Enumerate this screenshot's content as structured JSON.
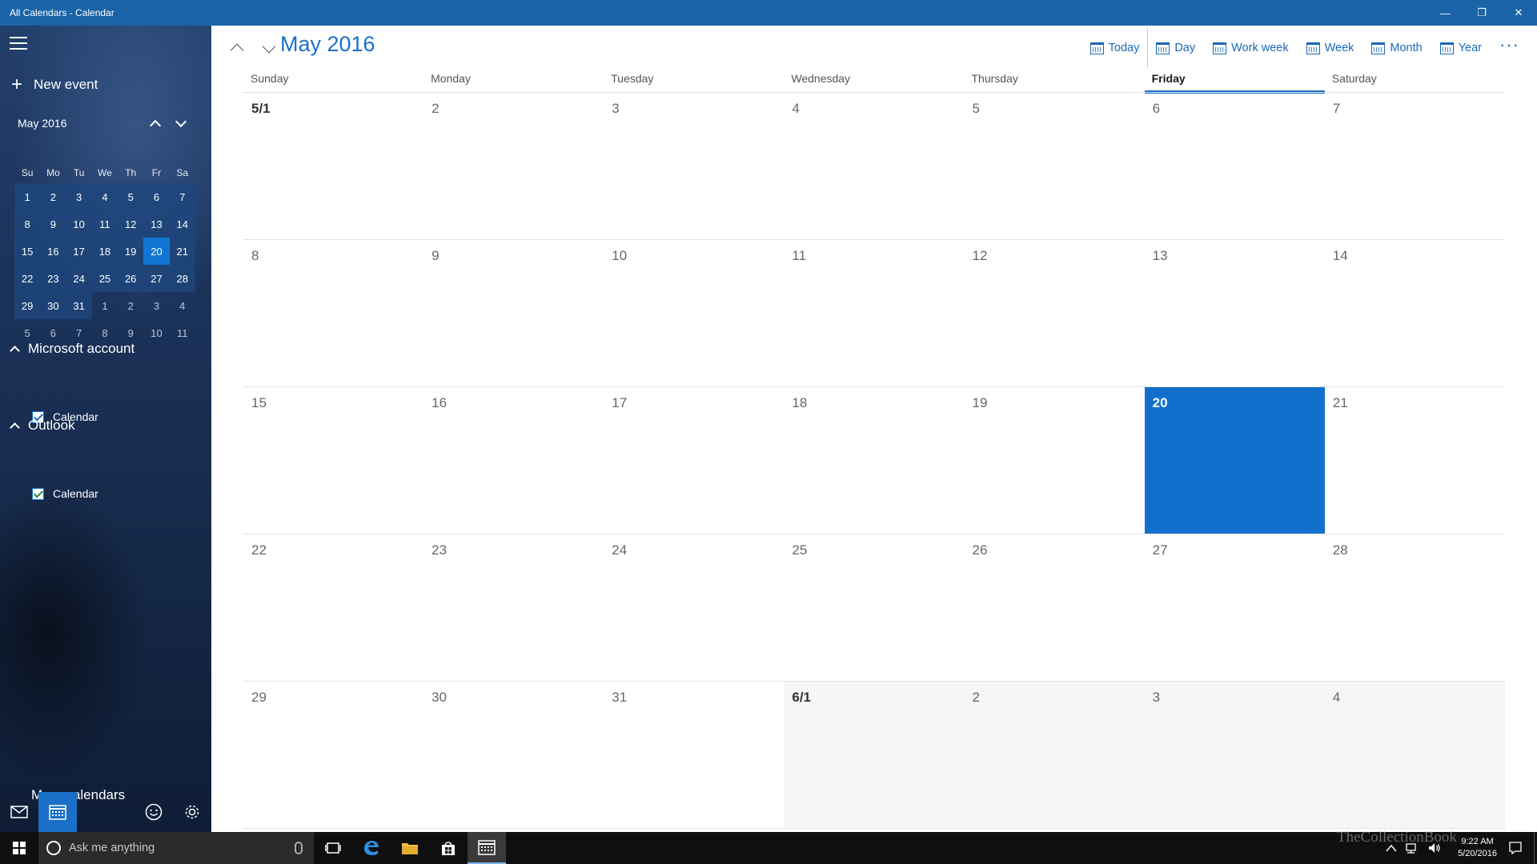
{
  "window": {
    "title": "All Calendars - Calendar",
    "minimize": "—",
    "restore": "❐",
    "close": "✕"
  },
  "sidebar": {
    "new_event_plus": "+",
    "new_event": "New event",
    "mini_calendar": {
      "title": "May 2016",
      "weekdays": [
        "Su",
        "Mo",
        "Tu",
        "We",
        "Th",
        "Fr",
        "Sa"
      ],
      "weeks": [
        [
          "1",
          "2",
          "3",
          "4",
          "5",
          "6",
          "7"
        ],
        [
          "8",
          "9",
          "10",
          "11",
          "12",
          "13",
          "14"
        ],
        [
          "15",
          "16",
          "17",
          "18",
          "19",
          "20",
          "21"
        ],
        [
          "22",
          "23",
          "24",
          "25",
          "26",
          "27",
          "28"
        ],
        [
          "29",
          "30",
          "31",
          "1",
          "2",
          "3",
          "4"
        ],
        [
          "5",
          "6",
          "7",
          "8",
          "9",
          "10",
          "11"
        ]
      ],
      "selected": "20"
    },
    "accounts": [
      {
        "name": "Microsoft account",
        "calendar": "Calendar"
      },
      {
        "name": "Outlook",
        "calendar": "Calendar"
      }
    ],
    "more_calendars": "More calendars"
  },
  "toolbar": {
    "month_title": "May 2016",
    "today": "Today",
    "day": "Day",
    "work_week": "Work week",
    "week": "Week",
    "month": "Month",
    "year": "Year",
    "more": "···"
  },
  "month_view": {
    "weekdays": [
      "Sunday",
      "Monday",
      "Tuesday",
      "Wednesday",
      "Thursday",
      "Friday",
      "Saturday"
    ],
    "today_column": 5,
    "weeks": [
      [
        "5/1",
        "2",
        "3",
        "4",
        "5",
        "6",
        "7"
      ],
      [
        "8",
        "9",
        "10",
        "11",
        "12",
        "13",
        "14"
      ],
      [
        "15",
        "16",
        "17",
        "18",
        "19",
        "20",
        "21"
      ],
      [
        "22",
        "23",
        "24",
        "25",
        "26",
        "27",
        "28"
      ],
      [
        "29",
        "30",
        "31",
        "6/1",
        "2",
        "3",
        "4"
      ]
    ],
    "today_cell": "20"
  },
  "taskbar": {
    "search_placeholder": "Ask me anything",
    "time": "9:22 AM",
    "date": "5/20/2016"
  },
  "watermark": "TheCollectionBook",
  "colors": {
    "accent": "#1a6fc9",
    "titlebar": "#1a64a7",
    "today_fill": "#1270cc",
    "taskbar": "#0f0f0f"
  }
}
